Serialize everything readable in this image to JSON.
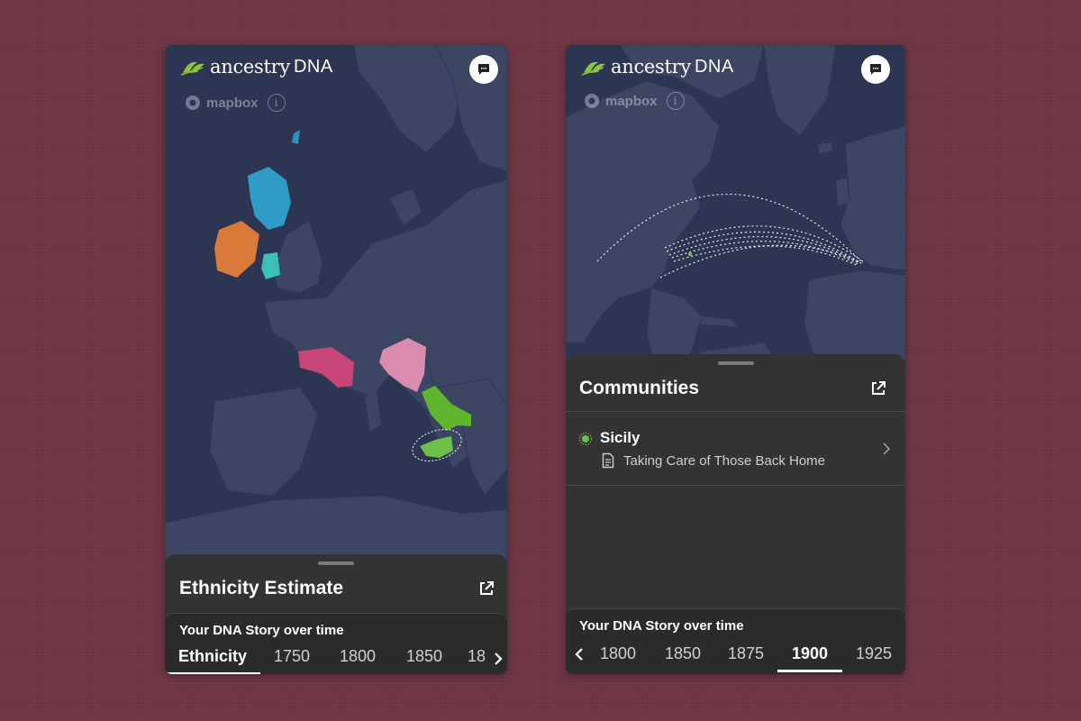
{
  "left_screen": {
    "logo": {
      "word": "ancestry",
      "suffix": "DNA"
    },
    "mapbox": {
      "label": "mapbox",
      "info": "i"
    },
    "sheet": {
      "title": "Ethnicity Estimate",
      "timeline_title": "Your DNA Story over time",
      "tabs": [
        "Ethnicity",
        "1750",
        "1800",
        "1850",
        "18"
      ],
      "active_tab": "Ethnicity"
    },
    "regions": [
      {
        "name": "Scotland",
        "color": "#2f9cc7"
      },
      {
        "name": "Ireland",
        "color": "#d9793a"
      },
      {
        "name": "Wales",
        "color": "#3cbfb4"
      },
      {
        "name": "Southern France",
        "color": "#c8457a"
      },
      {
        "name": "Northern Italy",
        "color": "#d98cae"
      },
      {
        "name": "Southern Italy",
        "color": "#5fb52e"
      },
      {
        "name": "Sicily",
        "color": "#6fc04a"
      }
    ]
  },
  "right_screen": {
    "logo": {
      "word": "ancestry",
      "suffix": "DNA"
    },
    "mapbox": {
      "label": "mapbox",
      "info": "i"
    },
    "sheet": {
      "title": "Communities",
      "community": {
        "name": "Sicily",
        "subtitle": "Taking Care of Those Back Home"
      },
      "timeline_title": "Your DNA Story over time",
      "tabs": [
        "1800",
        "1850",
        "1875",
        "1900",
        "1925"
      ],
      "active_tab": "1900"
    }
  },
  "colors": {
    "map_water": "#2c3551",
    "map_land": "#3c4663",
    "sheet_bg": "#333333",
    "accent_green": "#6fc04a"
  }
}
